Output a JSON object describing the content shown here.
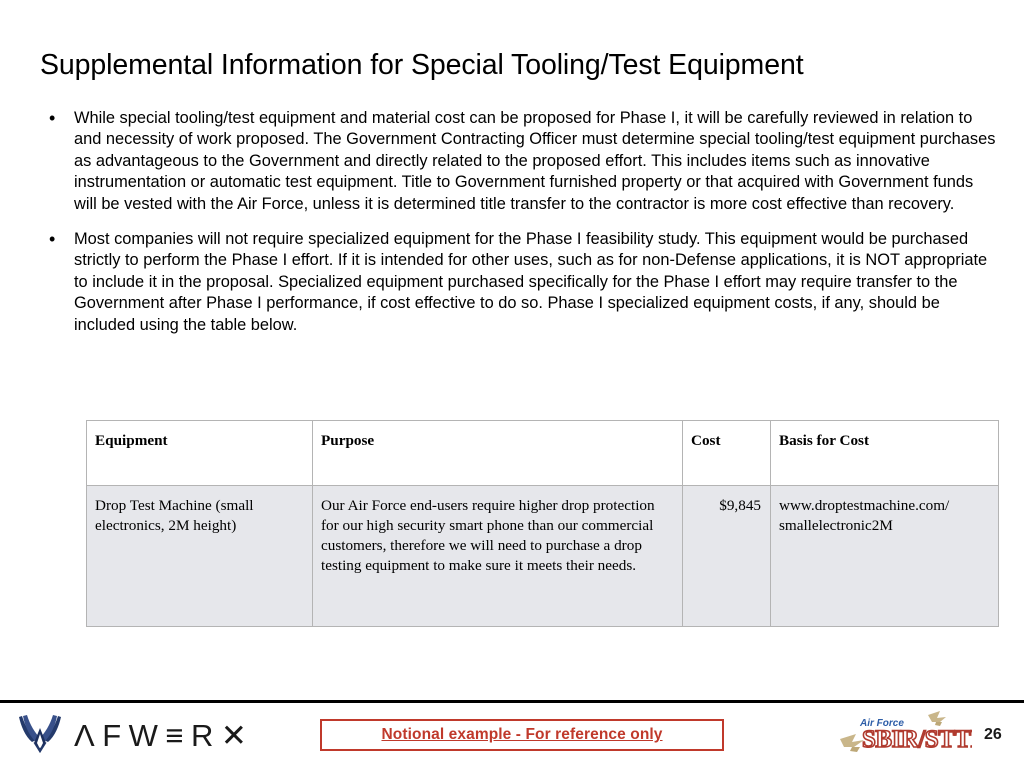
{
  "slide": {
    "title": "Supplemental Information for Special Tooling/Test Equipment",
    "page_number": "26"
  },
  "bullets": [
    {
      "marker": "•",
      "text": "While special tooling/test equipment and material cost can be proposed for Phase I, it will be carefully reviewed in relation to and necessity of work proposed. The Government Contracting Officer must determine special tooling/test equipment purchases as advantageous to the Government and directly related to the proposed effort. This includes items such as innovative instrumentation or automatic test equipment. Title to Government furnished property or that acquired with Government funds will be vested with the Air Force, unless it is determined title transfer to the contractor is more cost effective than recovery."
    },
    {
      "marker": "•",
      "text": "Most companies will not require specialized equipment for the Phase I feasibility study. This equipment would be purchased strictly to perform the Phase I effort.  If it is intended for other uses, such as for non-Defense applications, it is NOT appropriate to include it in the proposal. Specialized equipment purchased specifically for the Phase I effort may require transfer to the Government after Phase I performance, if cost effective to do so. Phase I specialized equipment costs, if any, should be included using the table below."
    }
  ],
  "table": {
    "headers": {
      "equipment": "Equipment",
      "purpose": "Purpose",
      "cost": "Cost",
      "basis": "Basis for Cost"
    },
    "rows": [
      {
        "equipment": "Drop Test Machine  (small electronics, 2M height)",
        "purpose": "Our Air Force end-users require higher drop protection for our high security smart phone than our commercial customers, therefore we will need to purchase a drop testing equipment to make sure it meets their needs.",
        "cost": "$9,845",
        "basis": "www.droptestmachine.com/ smallelectronic2M"
      }
    ]
  },
  "footer": {
    "afwerx_wordmark": "AFWERX",
    "afwerx_letters": [
      "Λ",
      "F",
      "W",
      "≡",
      "R",
      "✕"
    ],
    "notional_note": "Notional example - For reference only",
    "sbir_top_label": "Air Force",
    "sbir_main_label": "SBIR/STTR"
  },
  "colors": {
    "accent_red": "#c0392b",
    "af_navy": "#1c2f5e",
    "sbir_red": "#b03a2e",
    "table_row_bg": "#e6e7eb",
    "table_border": "#b4b4b4"
  }
}
